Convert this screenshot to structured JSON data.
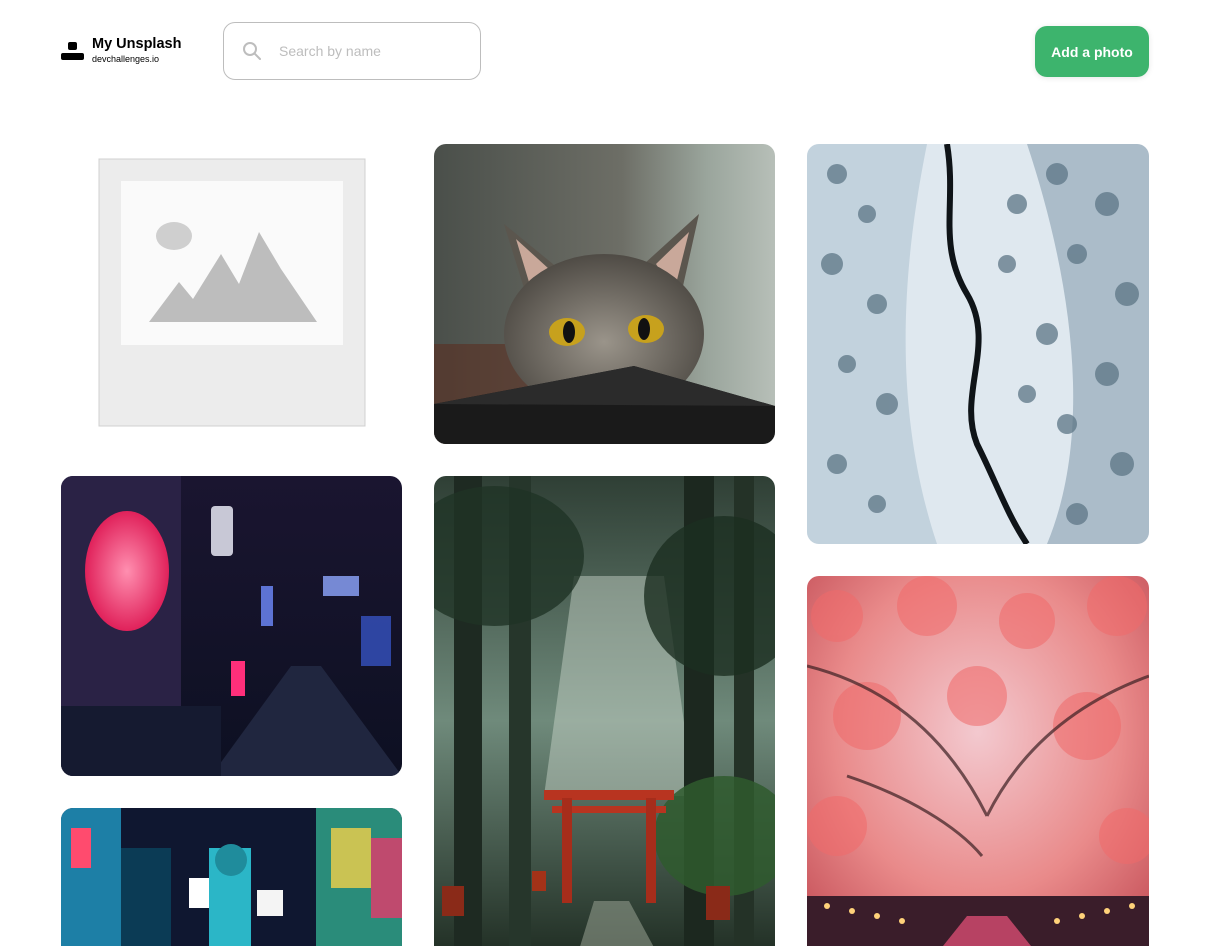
{
  "brand": {
    "title": "My Unsplash",
    "subtitle": "devchallenges.io"
  },
  "search": {
    "placeholder": "Search by name",
    "value": "",
    "icon": "search-icon"
  },
  "actions": {
    "add_photo_label": "Add a photo"
  },
  "colors": {
    "accent": "#3db46d",
    "input_border": "#bdbdbd",
    "placeholder": "#bdbdbd"
  },
  "gallery": {
    "photos": [
      {
        "subject": "image placeholder",
        "kind": "placeholder"
      },
      {
        "subject": "cat peeking over a box",
        "kind": "photo"
      },
      {
        "subject": "aerial snowy forest with river",
        "kind": "photo"
      },
      {
        "subject": "neon lantern street at night",
        "kind": "photo"
      },
      {
        "subject": "torii gate in forest",
        "kind": "photo"
      },
      {
        "subject": "cherry blossoms over river",
        "kind": "photo"
      },
      {
        "subject": "neon city intersection at night",
        "kind": "photo"
      }
    ]
  }
}
